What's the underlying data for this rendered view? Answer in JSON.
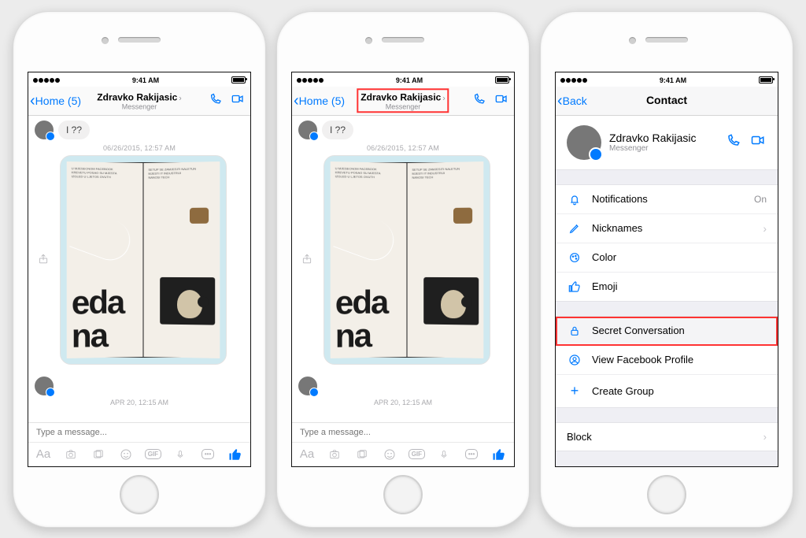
{
  "status": {
    "time": "9:41 AM"
  },
  "chat": {
    "back_label": "Home (5)",
    "title": "Zdravko Rakijasic",
    "subtitle": "Messenger",
    "msg_text": "I ??",
    "ts1": "06/26/2015, 12:57 AM",
    "ts2": "APR 20, 12:15 AM",
    "photo_word_left": "eda",
    "photo_word_bottom": "na",
    "input_placeholder": "Type a message..."
  },
  "toolbar": {
    "aa": "Aa",
    "gif": "GIF",
    "more": "•••"
  },
  "contact": {
    "back_label": "Back",
    "nav_title": "Contact",
    "name": "Zdravko Rakijasic",
    "subtitle": "Messenger",
    "notifications": "Notifications",
    "notifications_state": "On",
    "nicknames": "Nicknames",
    "color": "Color",
    "emoji": "Emoji",
    "secret": "Secret Conversation",
    "profile": "View Facebook Profile",
    "group": "Create Group",
    "block": "Block"
  }
}
